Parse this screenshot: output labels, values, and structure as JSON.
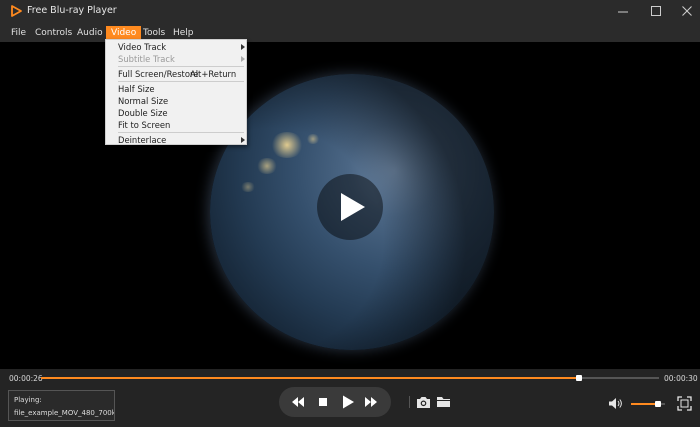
{
  "window": {
    "title": "Free Blu-ray Player",
    "accent_color": "#ff8a1f"
  },
  "menubar": {
    "items": [
      {
        "label": "File"
      },
      {
        "label": "Controls"
      },
      {
        "label": "Audio"
      },
      {
        "label": "Video",
        "active": true
      },
      {
        "label": "Tools"
      },
      {
        "label": "Help"
      }
    ]
  },
  "video_menu": {
    "items": [
      {
        "label": "Video Track",
        "submenu": true,
        "enabled": true
      },
      {
        "label": "Subtitle Track",
        "submenu": true,
        "enabled": false
      },
      {
        "label": "Full Screen/Restore",
        "accelerator": "Alt+Return",
        "enabled": true
      },
      {
        "label": "Half Size",
        "enabled": true
      },
      {
        "label": "Normal Size",
        "enabled": true
      },
      {
        "label": "Double Size",
        "enabled": true
      },
      {
        "label": "Fit to Screen",
        "enabled": true
      },
      {
        "label": "Deinterlace",
        "submenu": true,
        "enabled": true
      }
    ]
  },
  "playback": {
    "current_time": "00:00:26",
    "total_time": "00:00:30",
    "progress_fraction": 0.87,
    "volume_fraction": 0.8
  },
  "now_playing": {
    "label": "Playing:",
    "file": "file_example_MOV_480_700kB.mov"
  },
  "icons": {
    "logo": "play-triangle-logo-icon",
    "minimize": "minimize-icon",
    "maximize": "maximize-icon",
    "close": "close-icon",
    "rewind": "rewind-icon",
    "stop": "stop-icon",
    "play": "play-icon",
    "fast_forward": "fast-forward-icon",
    "snapshot": "camera-icon",
    "open_folder": "folder-icon",
    "volume": "volume-icon",
    "fullscreen": "fullscreen-icon"
  }
}
